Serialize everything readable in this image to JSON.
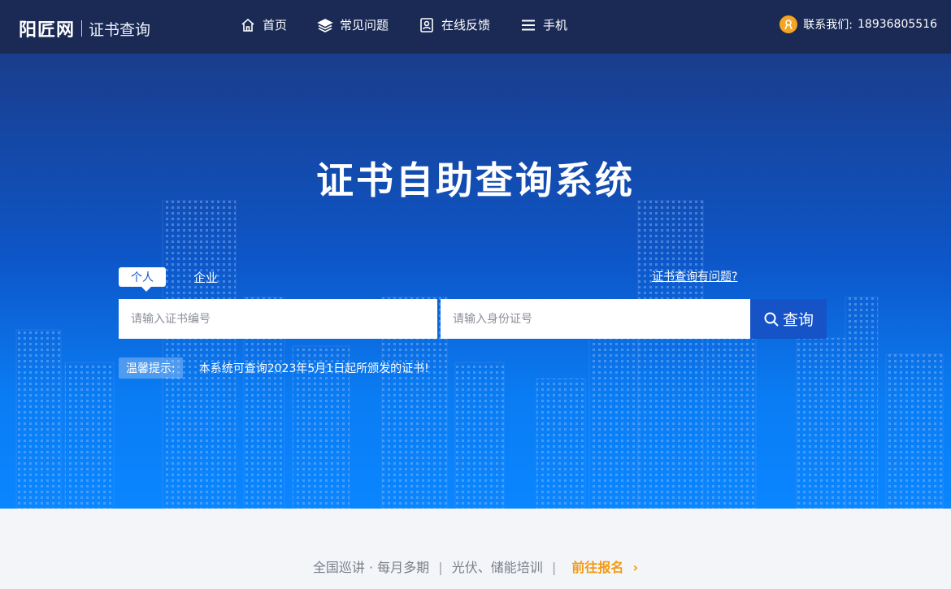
{
  "header": {
    "logo_main": "阳匠网",
    "logo_sub": "证书查询",
    "nav": [
      {
        "label": "首页",
        "icon": "home-icon"
      },
      {
        "label": "常见问题",
        "icon": "layers-icon"
      },
      {
        "label": "在线反馈",
        "icon": "feedback-icon"
      },
      {
        "label": "手机",
        "icon": "menu-icon"
      }
    ],
    "contact_label": "联系我们:",
    "contact_phone": "18936805516"
  },
  "hero": {
    "title": "证书自助查询系统",
    "tabs": [
      "个人",
      "企业"
    ],
    "help_link": "证书查询有问题?",
    "cert_placeholder": "请输入证书编号",
    "id_placeholder": "请输入身份证号",
    "search_button": "查询",
    "tip_label": "温馨提示:",
    "tip_text": "本系统可查询2023年5月1日起所颁发的证书!"
  },
  "promo": {
    "part1": "全国巡讲 · 每月多期",
    "part2": "光伏、储能培训",
    "cta": "前往报名"
  },
  "colors": {
    "header_bg": "#1b2a55",
    "accent": "#1553c7",
    "cta": "#f39a12"
  }
}
